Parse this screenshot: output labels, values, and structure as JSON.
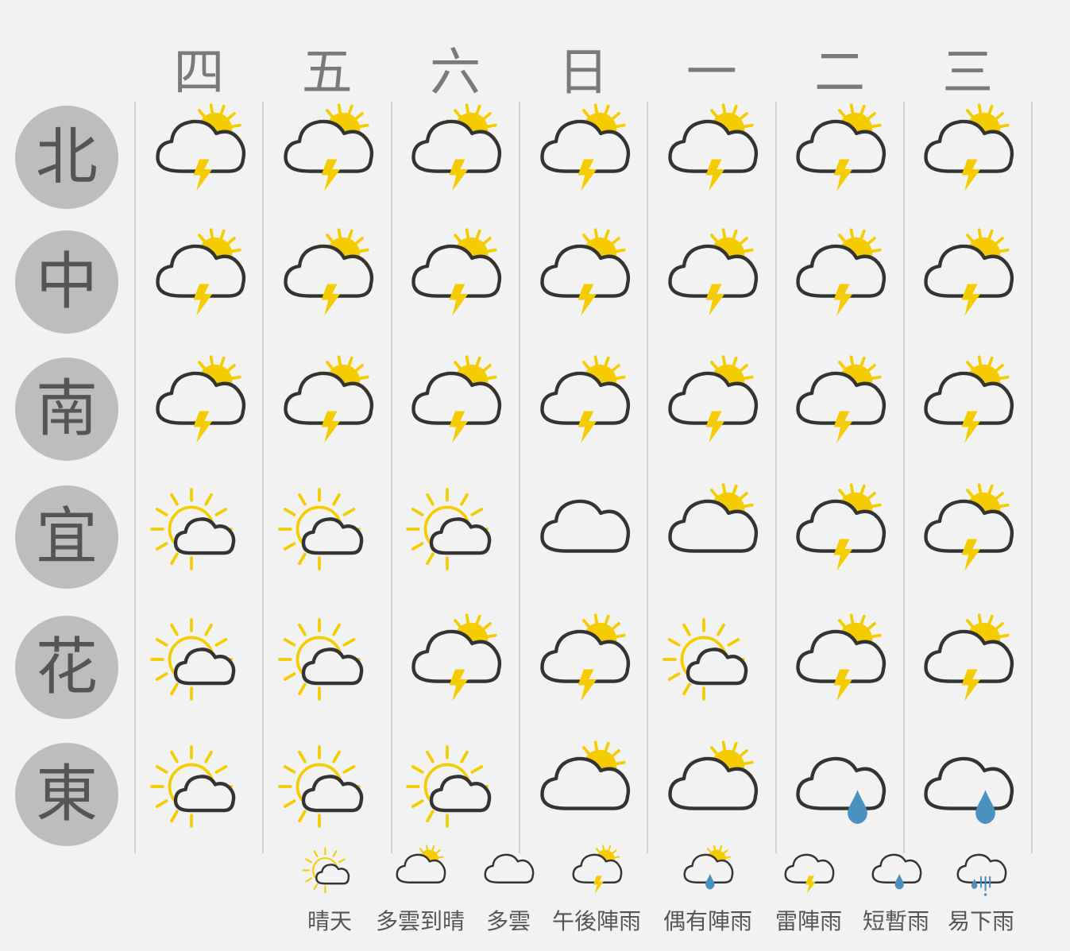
{
  "days": [
    "四",
    "五",
    "六",
    "日",
    "一",
    "二",
    "三"
  ],
  "regions": [
    "北",
    "中",
    "南",
    "宜",
    "花",
    "東"
  ],
  "forecast": [
    [
      "afternoon_showers",
      "afternoon_showers",
      "afternoon_showers",
      "afternoon_showers",
      "afternoon_showers",
      "afternoon_showers",
      "afternoon_showers"
    ],
    [
      "afternoon_showers",
      "afternoon_showers",
      "afternoon_showers",
      "afternoon_showers",
      "afternoon_showers",
      "afternoon_showers",
      "afternoon_showers"
    ],
    [
      "afternoon_showers",
      "afternoon_showers",
      "afternoon_showers",
      "afternoon_showers",
      "afternoon_showers",
      "afternoon_showers",
      "afternoon_showers"
    ],
    [
      "sunny",
      "sunny",
      "sunny",
      "cloudy",
      "partly_cloudy",
      "afternoon_showers",
      "afternoon_showers"
    ],
    [
      "sunny",
      "sunny",
      "afternoon_showers",
      "afternoon_showers",
      "sunny",
      "afternoon_showers",
      "afternoon_showers"
    ],
    [
      "sunny",
      "sunny",
      "sunny",
      "partly_cloudy",
      "partly_cloudy",
      "rain",
      "rain"
    ]
  ],
  "legend": [
    {
      "icon": "sunny",
      "label": "晴天"
    },
    {
      "icon": "partly_cloudy",
      "label": "多雲到晴"
    },
    {
      "icon": "cloudy",
      "label": "多雲"
    },
    {
      "icon": "afternoon_showers",
      "label": "午後陣雨"
    },
    {
      "icon": "occasional_showers",
      "label": "偶有陣雨"
    },
    {
      "icon": "thunder_showers",
      "label": "雷陣雨"
    },
    {
      "icon": "brief_rain",
      "label": "短暫雨"
    },
    {
      "icon": "easy_rain",
      "label": "易下雨"
    }
  ],
  "colors": {
    "background": "#f2f2f2",
    "sun": "#f4cc00",
    "cloud_stroke": "#333333",
    "rain_drop": "#4a90c0",
    "region_circle": "#bdbdbd",
    "grid_line": "#d2d2d2"
  }
}
